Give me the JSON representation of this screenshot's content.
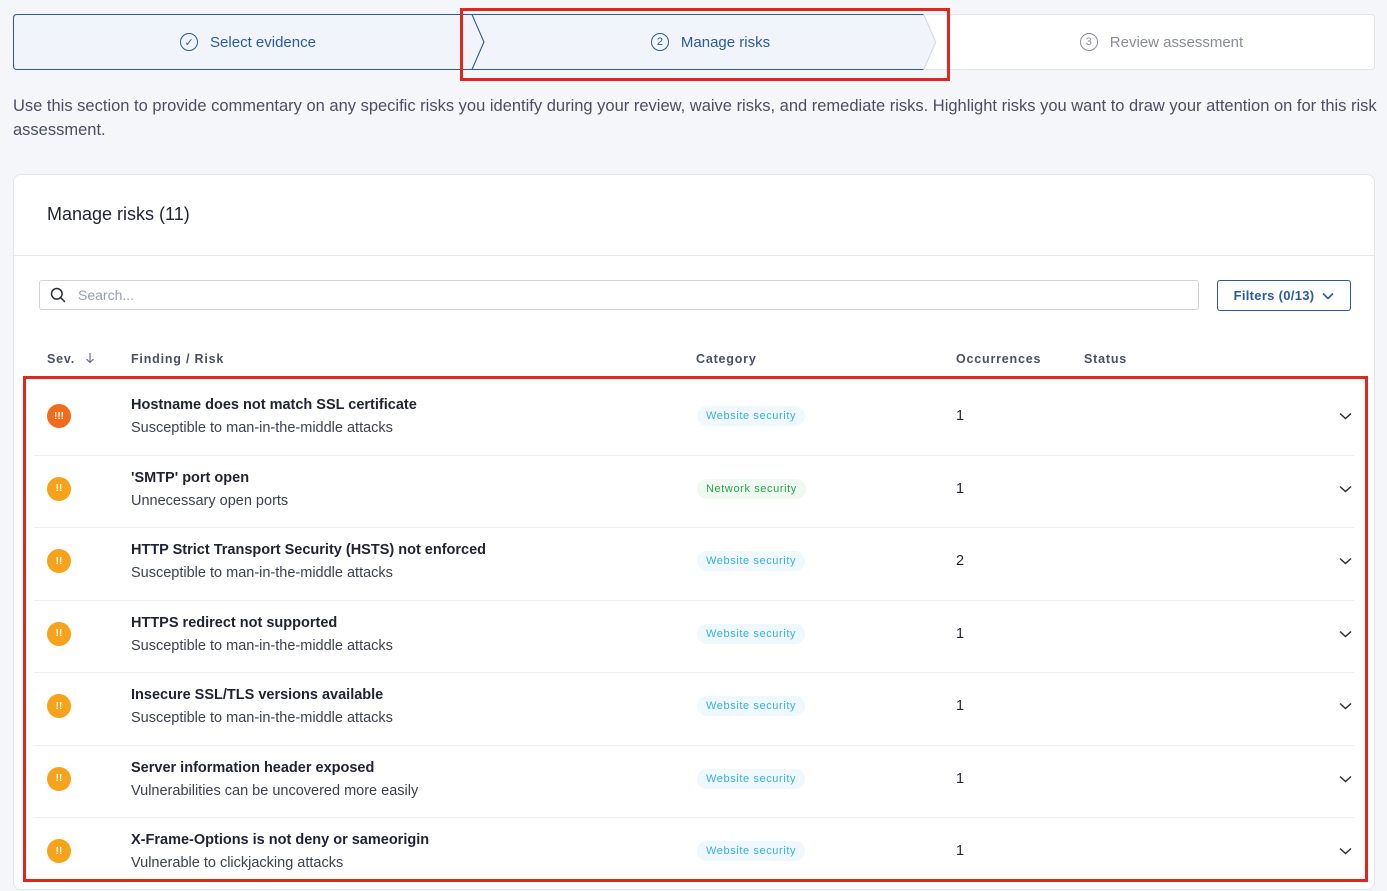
{
  "stepper": {
    "steps": [
      {
        "num": "✓",
        "label": "Select evidence",
        "state": "done"
      },
      {
        "num": "2",
        "label": "Manage risks",
        "state": "current"
      },
      {
        "num": "3",
        "label": "Review assessment",
        "state": "upcoming"
      }
    ]
  },
  "intro": "Use this section to provide commentary on any specific risks you identify during your review, waive risks, and remediate risks. Highlight risks you want to draw your attention on for this risk assessment.",
  "card": {
    "title": "Manage risks (11)",
    "search_placeholder": "Search...",
    "filters_label": "Filters (0/13)"
  },
  "table": {
    "headers": {
      "sev": "Sev.",
      "finding": "Finding / Risk",
      "category": "Category",
      "occurrences": "Occurrences",
      "status": "Status"
    },
    "rows": [
      {
        "severity": "high",
        "icon": "!!!",
        "title": "Hostname does not match SSL certificate",
        "subtitle": "Susceptible to man-in-the-middle attacks",
        "category": "Website security",
        "occurrences": "1"
      },
      {
        "severity": "medium",
        "icon": "!!",
        "title": "'SMTP' port open",
        "subtitle": "Unnecessary open ports",
        "category": "Network security",
        "occurrences": "1"
      },
      {
        "severity": "medium",
        "icon": "!!",
        "title": "HTTP Strict Transport Security (HSTS) not enforced",
        "subtitle": "Susceptible to man-in-the-middle attacks",
        "category": "Website security",
        "occurrences": "2"
      },
      {
        "severity": "medium",
        "icon": "!!",
        "title": "HTTPS redirect not supported",
        "subtitle": "Susceptible to man-in-the-middle attacks",
        "category": "Website security",
        "occurrences": "1"
      },
      {
        "severity": "medium",
        "icon": "!!",
        "title": "Insecure SSL/TLS versions available",
        "subtitle": "Susceptible to man-in-the-middle attacks",
        "category": "Website security",
        "occurrences": "1"
      },
      {
        "severity": "medium",
        "icon": "!!",
        "title": "Server information header exposed",
        "subtitle": "Vulnerabilities can be uncovered more easily",
        "category": "Website security",
        "occurrences": "1"
      },
      {
        "severity": "medium",
        "icon": "!!",
        "title": "X-Frame-Options is not deny or sameorigin",
        "subtitle": "Vulnerable to clickjacking attacks",
        "category": "Website security",
        "occurrences": "1"
      }
    ]
  },
  "colors": {
    "primary": "#2a5a9c",
    "severity_high": "#f26a1b",
    "severity_medium": "#f7a21b",
    "website_badge_text": "#3ab0de",
    "website_badge_bg": "#eef8fd",
    "network_badge_text": "#2ea34b",
    "network_badge_bg": "#eefaf1",
    "annotation": "#e1261c"
  }
}
